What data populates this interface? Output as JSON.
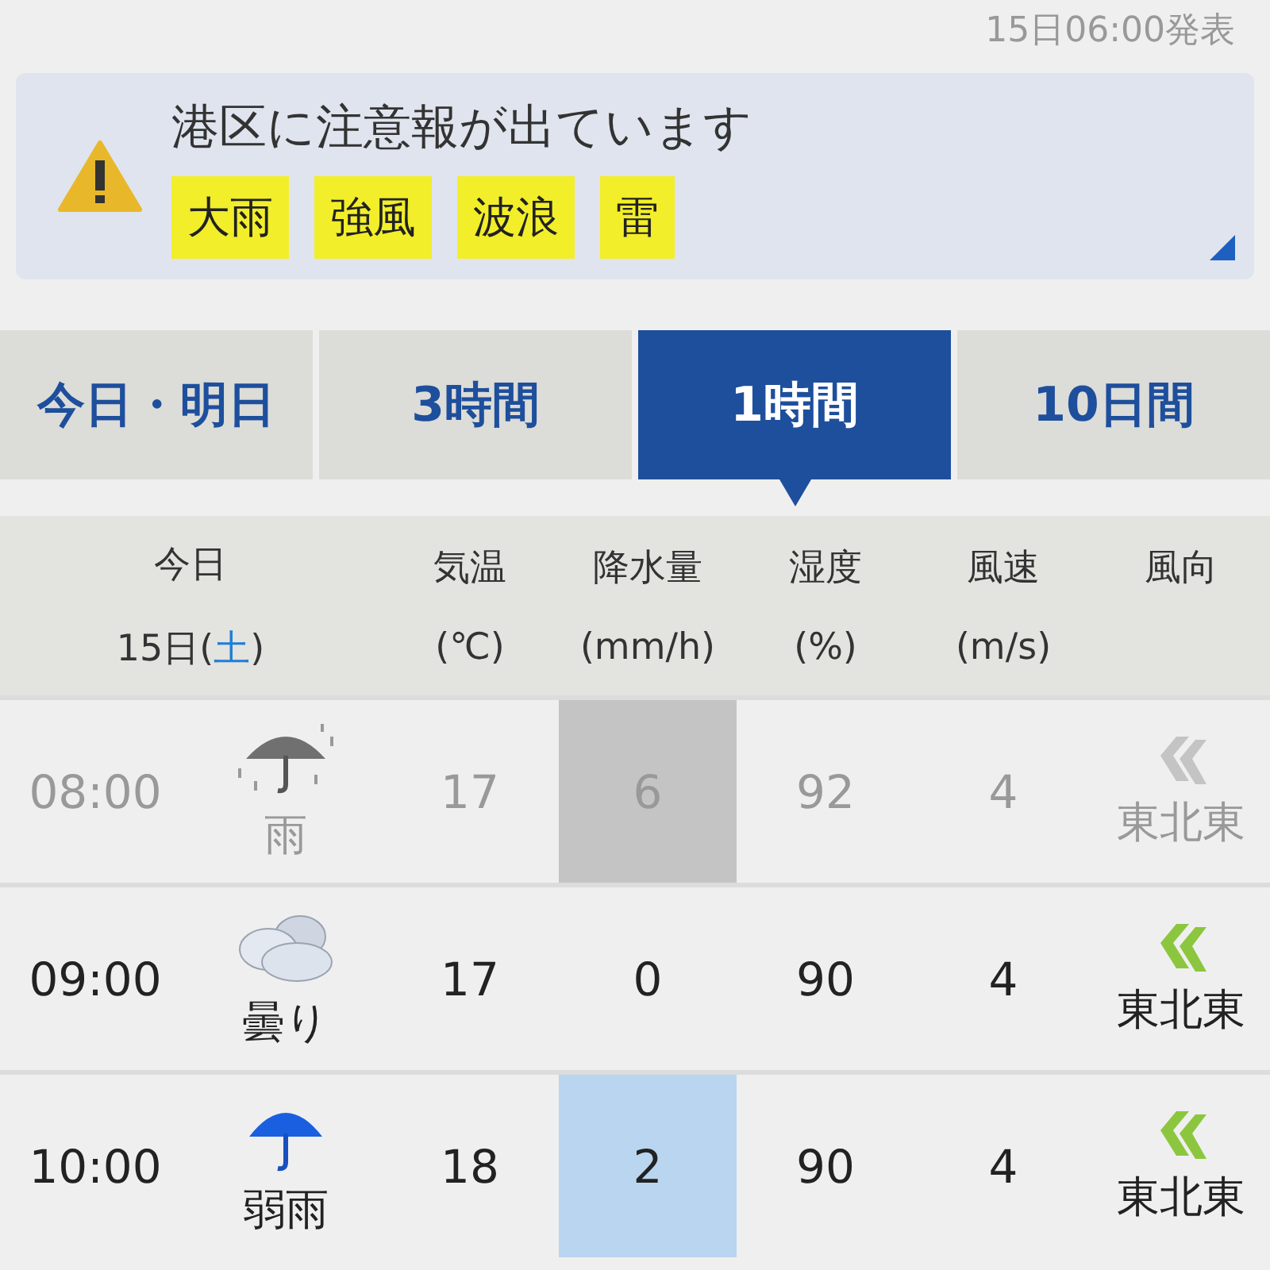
{
  "published": "15日06:00発表",
  "alert": {
    "title": "港区に注意報が出ています",
    "tags": [
      "大雨",
      "強風",
      "波浪",
      "雷"
    ]
  },
  "tabs": [
    {
      "label": "今日・明日",
      "selected": false
    },
    {
      "label": "3時間",
      "selected": false
    },
    {
      "label": "1時間",
      "selected": true
    },
    {
      "label": "10日間",
      "selected": false
    }
  ],
  "table": {
    "day": "今日",
    "date_prefix": "15日(",
    "weekday": "土",
    "date_suffix": ")",
    "columns": [
      {
        "title": "気温",
        "unit": "(℃)"
      },
      {
        "title": "降水量",
        "unit": "(mm/h)"
      },
      {
        "title": "湿度",
        "unit": "(%)"
      },
      {
        "title": "風速",
        "unit": "(m/s)"
      },
      {
        "title": "風向"
      }
    ],
    "rows": [
      {
        "time": "08:00",
        "kind": "rain",
        "weather_label": "雨",
        "temp": "17",
        "precip": "6",
        "humidity": "92",
        "wind_speed": "4",
        "wind_dir": "東北東",
        "past": true,
        "rain_highlight": true
      },
      {
        "time": "09:00",
        "kind": "cloudy",
        "weather_label": "曇り",
        "temp": "17",
        "precip": "0",
        "humidity": "90",
        "wind_speed": "4",
        "wind_dir": "東北東",
        "past": false,
        "rain_highlight": false
      },
      {
        "time": "10:00",
        "kind": "light_rain",
        "weather_label": "弱雨",
        "temp": "18",
        "precip": "2",
        "humidity": "90",
        "wind_speed": "4",
        "wind_dir": "東北東",
        "past": false,
        "rain_highlight": true
      }
    ]
  }
}
